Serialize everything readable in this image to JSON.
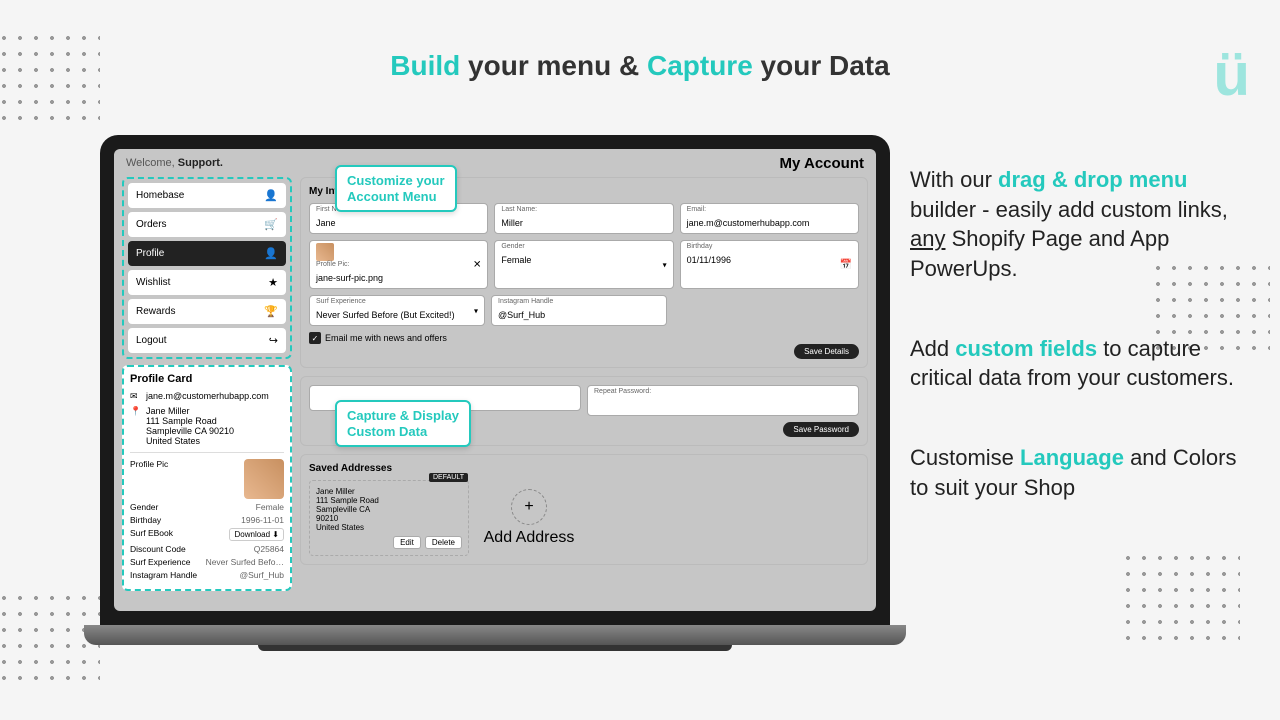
{
  "headline": {
    "pre": "Build",
    "mid": " your menu & ",
    "accent": "Capture",
    "post": " your Data"
  },
  "logo": "ü",
  "app": {
    "welcome_pre": "Welcome, ",
    "welcome_name": "Support.",
    "page_title": "My Account",
    "menu": [
      {
        "label": "Homebase",
        "icon": "👤"
      },
      {
        "label": "Orders",
        "icon": "🛒"
      },
      {
        "label": "Profile",
        "icon": "👤",
        "active": true
      },
      {
        "label": "Wishlist",
        "icon": "★"
      },
      {
        "label": "Rewards",
        "icon": "🏆"
      },
      {
        "label": "Logout",
        "icon": "↪"
      }
    ],
    "profile_card": {
      "title": "Profile Card",
      "email": "jane.m@customerhubapp.com",
      "name": "Jane Miller",
      "addr1": "111 Sample Road",
      "addr2": "Sampleville CA 90210",
      "country": "United States",
      "rows": [
        {
          "k": "Profile Pic",
          "v": ""
        },
        {
          "k": "Gender",
          "v": "Female"
        },
        {
          "k": "Birthday",
          "v": "1996-11-01"
        },
        {
          "k": "Surf EBook",
          "v": "Download",
          "btn": true
        },
        {
          "k": "Discount Code",
          "v": "Q25864"
        },
        {
          "k": "Surf Experience",
          "v": "Never Surfed Befo…"
        },
        {
          "k": "Instagram Handle",
          "v": "@Surf_Hub"
        }
      ]
    },
    "info": {
      "title": "My Information",
      "fields": {
        "first_name": {
          "lbl": "First Name:",
          "val": "Jane"
        },
        "last_name": {
          "lbl": "Last Name:",
          "val": "Miller"
        },
        "email": {
          "lbl": "Email:",
          "val": "jane.m@customerhubapp.com"
        },
        "profile_pic": {
          "lbl": "Profile Pic:",
          "val": "jane-surf-pic.png"
        },
        "gender": {
          "lbl": "Gender",
          "val": "Female"
        },
        "birthday": {
          "lbl": "Birthday",
          "val": "01/11/1996"
        },
        "surf": {
          "lbl": "Surf Experience",
          "val": "Never Surfed Before (But Excited!)"
        },
        "insta": {
          "lbl": "Instagram Handle",
          "val": "@Surf_Hub"
        }
      },
      "checkbox": "Email me with news and offers",
      "save": "Save Details"
    },
    "password": {
      "repeat_lbl": "Repeat Password:",
      "save": "Save Password"
    },
    "addresses": {
      "title": "Saved Addresses",
      "default_badge": "DEFAULT",
      "card": {
        "name": "Jane Miller",
        "l1": "111 Sample Road",
        "l2": "Sampleville CA",
        "l3": "90210",
        "l4": "United States"
      },
      "edit": "Edit",
      "delete": "Delete",
      "add": "Add Address"
    }
  },
  "callouts": {
    "c1": "Customize your\nAccount Menu",
    "c2": "Capture & Display\nCustom Data"
  },
  "marketing": {
    "p1_pre": "With our ",
    "p1_accent": "drag & drop menu",
    "p1_mid": " builder - easily add custom links, ",
    "p1_u": "any",
    "p1_post": " Shopify Page and App PowerUps.",
    "p2_pre": "Add ",
    "p2_accent": "custom fields",
    "p2_post": " to capture critical data from your customers.",
    "p3_pre": "Customise ",
    "p3_accent": "Language",
    "p3_post": " and Colors to suit your Shop"
  }
}
